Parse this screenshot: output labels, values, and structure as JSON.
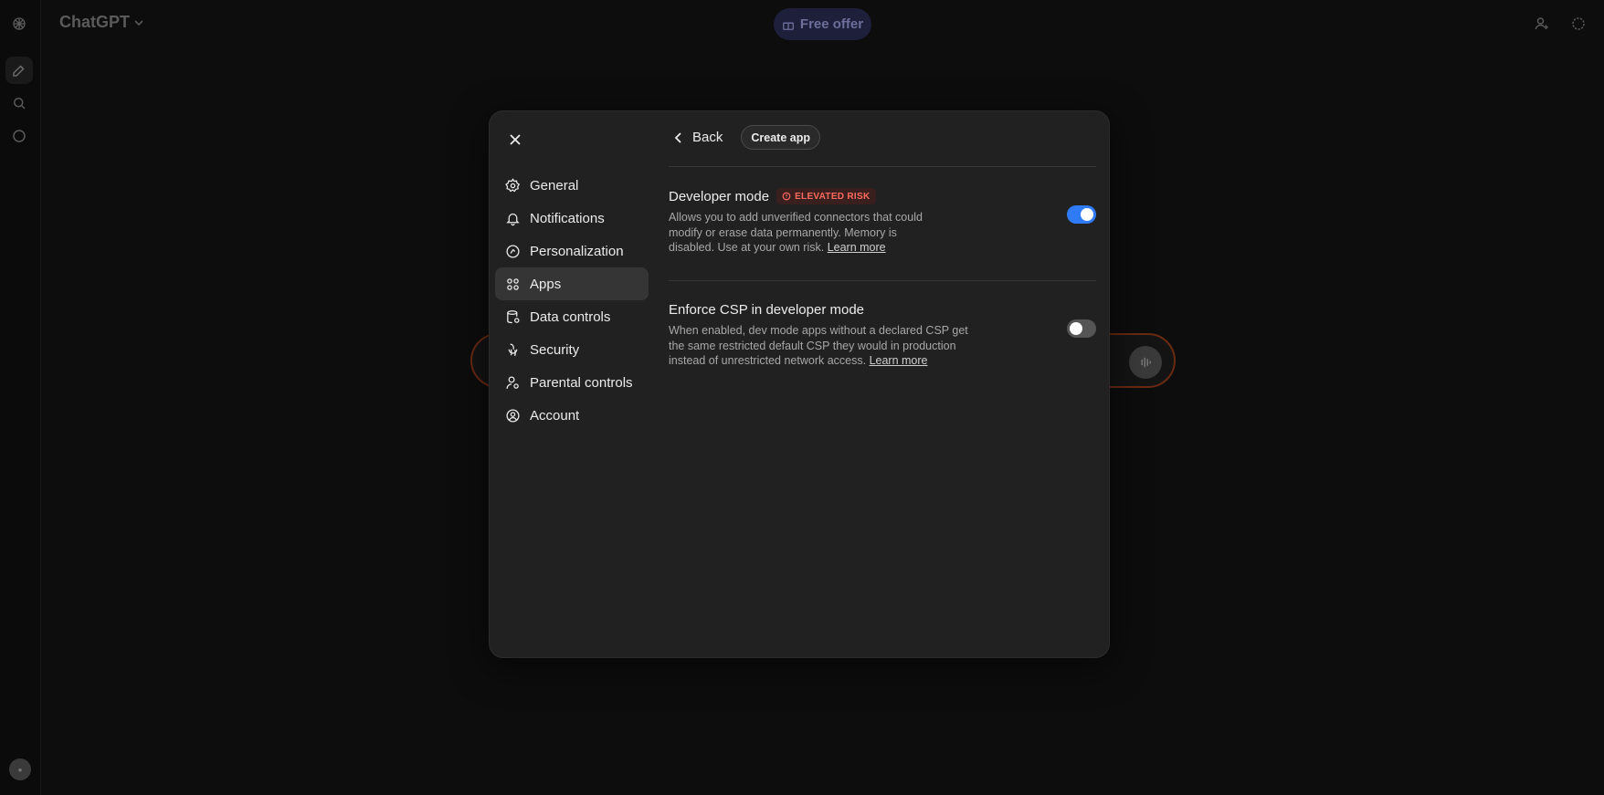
{
  "app": {
    "brand": "ChatGPT",
    "free_offer": "Free offer"
  },
  "settings_modal": {
    "nav": [
      {
        "label": "General",
        "icon": "gear-icon"
      },
      {
        "label": "Notifications",
        "icon": "bell-icon"
      },
      {
        "label": "Personalization",
        "icon": "personalization-icon"
      },
      {
        "label": "Apps",
        "icon": "apps-grid-icon",
        "active": true
      },
      {
        "label": "Data controls",
        "icon": "database-icon"
      },
      {
        "label": "Security",
        "icon": "shield-icon"
      },
      {
        "label": "Parental controls",
        "icon": "parental-icon"
      },
      {
        "label": "Account",
        "icon": "account-circle-icon"
      }
    ],
    "back_label": "Back",
    "create_app_label": "Create app",
    "developer_mode": {
      "title": "Developer mode",
      "badge": "ELEVATED RISK",
      "description": "Allows you to add unverified connectors that could modify or erase data permanently. Memory is disabled. Use at your own risk.",
      "link": "Learn more",
      "enabled": true
    },
    "enforce_csp": {
      "title": "Enforce CSP in developer mode",
      "description": "When enabled, dev mode apps without a declared CSP get the same restricted default CSP they would in production instead of unrestricted network access.",
      "link": "Learn more",
      "enabled": false
    }
  },
  "colors": {
    "accent_toggle_on": "#2f7bf6",
    "badge_text": "#ff6b5e",
    "modal_bg": "#212121"
  }
}
